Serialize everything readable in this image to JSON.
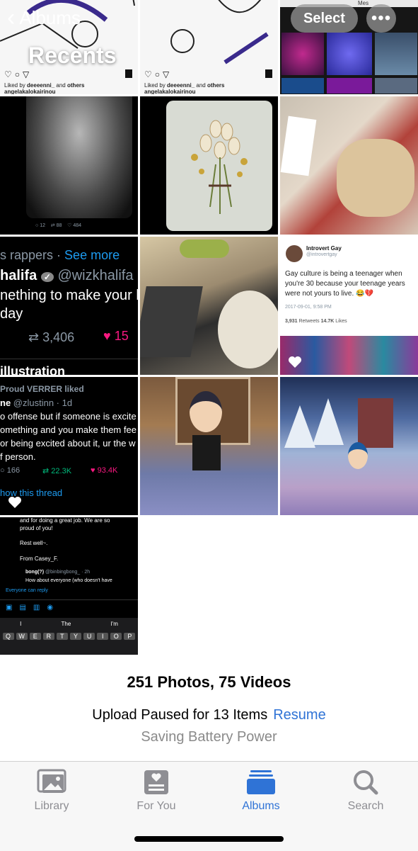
{
  "header": {
    "back_label": "Albums",
    "title": "Recents",
    "select_label": "Select",
    "more_label": "•••"
  },
  "tiles": {
    "ig1": {
      "liked_prefix": "Liked by",
      "liked_user": "deeeenni_",
      "liked_mid": "and",
      "liked_suffix": "others",
      "handle": "angelakalokairinou"
    },
    "ig2": {
      "liked_prefix": "Liked by",
      "liked_user": "deeeenni_",
      "liked_mid": "and",
      "liked_suffix": "others",
      "handle": "angelakalokairinou"
    },
    "top_right_tag": "Mes",
    "wolf_stats": {
      "replies": "12",
      "retweets": "88",
      "likes": "484"
    },
    "rappers": {
      "topic": "s rappers",
      "see_more": "See more",
      "name": "halifa",
      "handle": "@wizkhalifa · 1",
      "line1": "nething to make your b",
      "line2": "day",
      "retweets": "3,406",
      "likes": "15",
      "bottom": "illustration"
    },
    "introvert": {
      "name": "Introvert Gay",
      "handle": "@introvertgay",
      "text": "Gay culture is being a teenager when you're 30 because your teenage years were not yours to live. 😂💔",
      "date": "2017-09-01, 9:58 PM",
      "retweets_count": "3,931",
      "retweets_label": "Retweets",
      "likes_count": "14.7K",
      "likes_label": "Likes"
    },
    "verrer": {
      "liked": "Proud VERRER liked",
      "name": "ne",
      "handle": "@zlustinn · 1d",
      "l1": "o offense but if someone is excite",
      "l2": "omething and you make them fee",
      "l3": "or being excited about it, ur the w",
      "l4": "f person.",
      "replies": "166",
      "retweets": "22.3K",
      "likes": "93.4K",
      "show_thread": "how this thread"
    },
    "compose": {
      "l1": "and for doing a great job. We are so",
      "l2": "proud of you!",
      "l3": "Rest well~.",
      "l4": "From Casey_F.",
      "reply_name": "bong(?)",
      "reply_handle": "@binbingbong_ · 2h",
      "reply_text": "How about everyone (who doesn't have",
      "everyone": "Everyone can reply",
      "suggest": [
        "I",
        "The",
        "I'm"
      ],
      "keys": [
        "Q",
        "W",
        "E",
        "R",
        "T",
        "Y",
        "U",
        "I",
        "O",
        "P"
      ]
    }
  },
  "summary": {
    "count": "251 Photos, 75 Videos",
    "upload_text": "Upload Paused for 13 Items",
    "resume": "Resume",
    "battery": "Saving Battery Power"
  },
  "tabs": [
    {
      "label": "Library",
      "icon": "photo-library-icon",
      "active": false
    },
    {
      "label": "For You",
      "icon": "for-you-icon",
      "active": false
    },
    {
      "label": "Albums",
      "icon": "albums-icon",
      "active": true
    },
    {
      "label": "Search",
      "icon": "search-icon",
      "active": false
    }
  ],
  "colors": {
    "accent": "#2f73d6",
    "inactive": "#8e8e93",
    "heart_pink": "#f91880"
  }
}
